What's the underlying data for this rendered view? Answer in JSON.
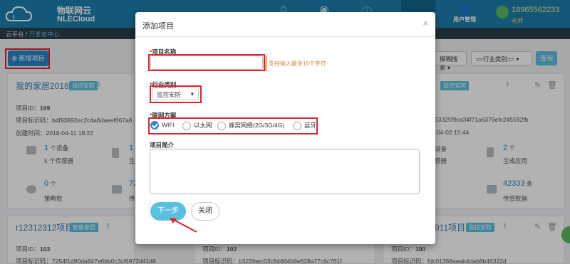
{
  "header": {
    "logo_line1": "物联网云",
    "logo_line2": "NLECloud",
    "user_mgmt": "用户管理",
    "phone": "18965562233",
    "role": "老师"
  },
  "breadcrumb": {
    "root": "云平台",
    "sep": "/",
    "current": "开发者中心"
  },
  "toolbar": {
    "new_project": "新增项目",
    "search_mode": "模糊搜索",
    "category": "==行业类别==",
    "query": "查询"
  },
  "cards": [
    {
      "title": "我的家居2018",
      "tag": "监控安防",
      "id_label": "项目ID：",
      "id": "169",
      "code_label": "项目标识码：",
      "code": "b4f93892ec2c4a6daeef667a6",
      "created_label": "创建时间：",
      "created": "2018-04-11 19:22",
      "devices_num": "1",
      "devices_unit": "个设备",
      "sensors": "5 个传感器",
      "gen_num": "1",
      "gen_label": "生成",
      "strategy_num": "0",
      "strategy_unit": "个",
      "strategy_label": "策略数",
      "data_num": "72",
      "data_label": "传"
    },
    {
      "tag": "监控安防",
      "code": "53325f9ca34f71a6376efc245592fb",
      "created": "-04-02 15:44",
      "devices_label": "设备",
      "sensors_label": "感器",
      "apps_num": "2",
      "apps_unit": "个",
      "apps_label": "生成应用",
      "data_num": "42333",
      "data_unit": "条",
      "data_label": "传感数据"
    },
    {
      "title": "r12312312项目",
      "tag": "智能家居",
      "id_label": "项目ID：",
      "id": "103",
      "code_label": "项目标识码：",
      "code": "7254f1d90da847e6bb0c3cf6972d41d8"
    },
    {
      "id_label": "项目ID：",
      "id": "102",
      "code_label": "项目标识码：",
      "code": "b322faec03c84664b6e628a77c6c761f"
    },
    {
      "title": "911项目",
      "tag": "监控安防",
      "id_label": "项目ID：",
      "id": "100",
      "code_label": "项目标识码：",
      "code": "fdc01368aeab4dab8b46322d"
    }
  ],
  "modal": {
    "title": "添加项目",
    "close": "×",
    "name_label": "项目名称",
    "name_value": "",
    "name_hint": "支持输入最多15个字符",
    "industry_label": "行业类别",
    "industry_value": "监控安防",
    "network_label": "联网方案",
    "network_options": [
      "WIFI",
      "以太网",
      "蜂窝网络(2G/3G/4G)",
      "蓝牙"
    ],
    "network_selected": "WIFI",
    "desc_label": "项目简介",
    "desc_value": "",
    "next": "下一步",
    "close_btn": "关闭"
  },
  "colors": {
    "header": "#1c7fae",
    "accent": "#2a86c8",
    "highlight": "#e0232f",
    "tag": "#5bc0de"
  }
}
